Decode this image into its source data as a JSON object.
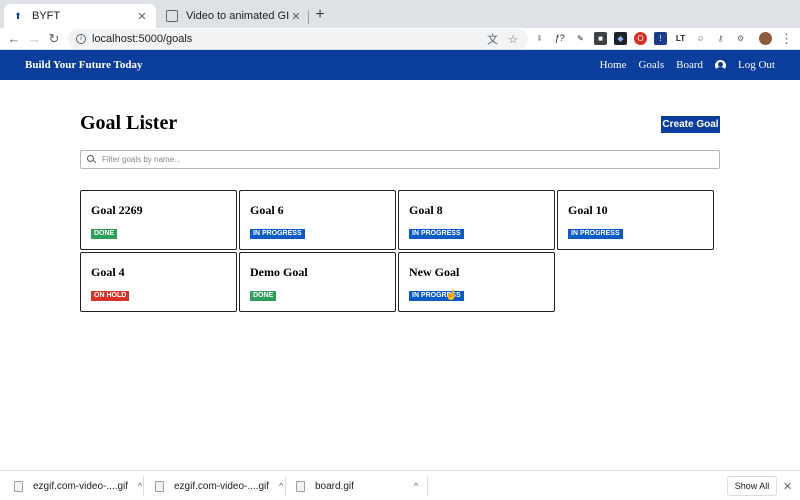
{
  "browser": {
    "tabs": [
      {
        "title": "BYFT",
        "active": true
      },
      {
        "title": "Video to animated GIF converter",
        "active": false
      }
    ],
    "close_glyph": "✕",
    "new_tab_glyph": "+",
    "url": "localhost:5000/goals",
    "nav": {
      "back": "←",
      "forward": "→",
      "reload": "↻"
    },
    "omnibox_icons": {
      "translate": "文",
      "bookmark": "☆"
    },
    "extensions": [
      {
        "name": "download-ext-icon",
        "color": "#9aa0a6",
        "glyph": "⬇"
      },
      {
        "name": "formula-ext-icon",
        "color": "#ffffff",
        "glyph": "ƒ?"
      },
      {
        "name": "pen-ext-icon",
        "color": "#1a73e8",
        "glyph": "✎"
      },
      {
        "name": "square-ext-icon",
        "color": "#3c4043",
        "glyph": "■"
      },
      {
        "name": "dark-ext-icon",
        "color": "#202124",
        "glyph": "◆"
      },
      {
        "name": "opera-ext-icon",
        "color": "#d93025",
        "glyph": "O"
      },
      {
        "name": "note-ext-icon",
        "color": "#1a3c8c",
        "glyph": "!"
      },
      {
        "name": "lt-ext-icon",
        "color": "#202124",
        "glyph": "LT"
      },
      {
        "name": "face-ext-icon",
        "color": "#80868b",
        "glyph": "☺"
      },
      {
        "name": "keys-ext-icon",
        "color": "#5f6368",
        "glyph": "⚷"
      },
      {
        "name": "gear-ext-icon",
        "color": "#5f6368",
        "glyph": "⚙"
      },
      {
        "name": "profile-avatar",
        "color": "#8d5a3b",
        "glyph": "●"
      }
    ],
    "menu_glyph": "⋮"
  },
  "header": {
    "brand": "Build Your Future Today",
    "links": {
      "home": "Home",
      "goals": "Goals",
      "board": "Board",
      "logout": "Log Out"
    }
  },
  "main": {
    "title": "Goal Lister",
    "create_label": "Create Goal",
    "search_placeholder": "Filter goals by name...",
    "goals": [
      {
        "title": "Goal 2269",
        "status": "DONE",
        "status_color": "#2e9e5b"
      },
      {
        "title": "Goal 6",
        "status": "IN PROGRESS",
        "status_color": "#0a5bc4"
      },
      {
        "title": "Goal 8",
        "status": "IN PROGRESS",
        "status_color": "#0a5bc4"
      },
      {
        "title": "Goal 10",
        "status": "IN PROGRESS",
        "status_color": "#0a5bc4"
      },
      {
        "title": "Goal 4",
        "status": "ON HOLD",
        "status_color": "#d6332a"
      },
      {
        "title": "Demo Goal",
        "status": "DONE",
        "status_color": "#2e9e5b"
      },
      {
        "title": "New Goal",
        "status": "IN PROGRESS",
        "status_color": "#0a5bc4"
      }
    ]
  },
  "downloads": {
    "items": [
      {
        "name": "ezgif.com-video-....gif"
      },
      {
        "name": "ezgif.com-video-....gif"
      },
      {
        "name": "board.gif"
      }
    ],
    "chevron_glyph": "^",
    "show_all": "Show All",
    "close_glyph": "✕"
  }
}
